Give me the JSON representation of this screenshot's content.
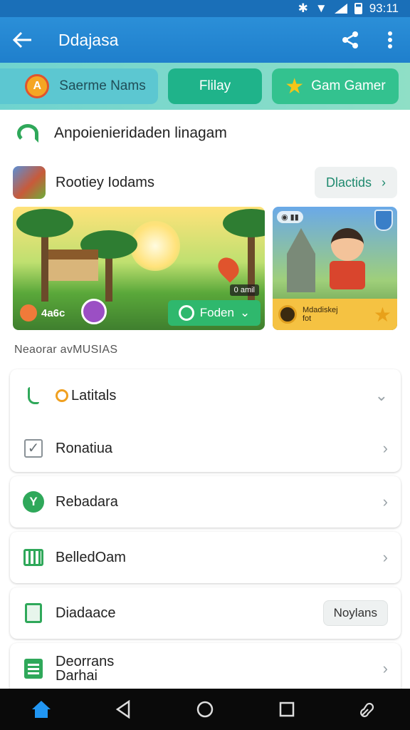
{
  "status_bar": {
    "time": "93:11"
  },
  "app_bar": {
    "title": "Ddajasa"
  },
  "chips": [
    {
      "label": "Saerme Nams"
    },
    {
      "label": "Flilay"
    },
    {
      "label": "Gam Gamer"
    }
  ],
  "headline": {
    "text": "Anpoienieridaden linagam"
  },
  "section": {
    "title": "Rootiey Iodams",
    "details_label": "Dlactids"
  },
  "banner_main": {
    "score": "4a6c",
    "timer": "0 amil",
    "button_label": "Foden"
  },
  "banner_side": {
    "level": "",
    "reward_line1": "Mdadiskej",
    "reward_line2": "fot"
  },
  "list_header": "Neaorar avMUSIAS",
  "list": [
    {
      "label": "Latitals",
      "trail": "chevron-down"
    },
    {
      "label": "Ronatiua",
      "trail": "chevron-right"
    },
    {
      "label": "Rebadara",
      "trail": "chevron-right"
    },
    {
      "label": "BelledOam",
      "trail": "chevron-right"
    },
    {
      "label": "Diadaace",
      "tag": "Noylans"
    },
    {
      "label_line1": "Deorrans",
      "label_line2": "Darhai",
      "trail": "chevron-right"
    }
  ],
  "colors": {
    "primary": "#1f7fcc",
    "accent_green": "#2fa85a",
    "chip_teal": "#5cc7d1"
  }
}
